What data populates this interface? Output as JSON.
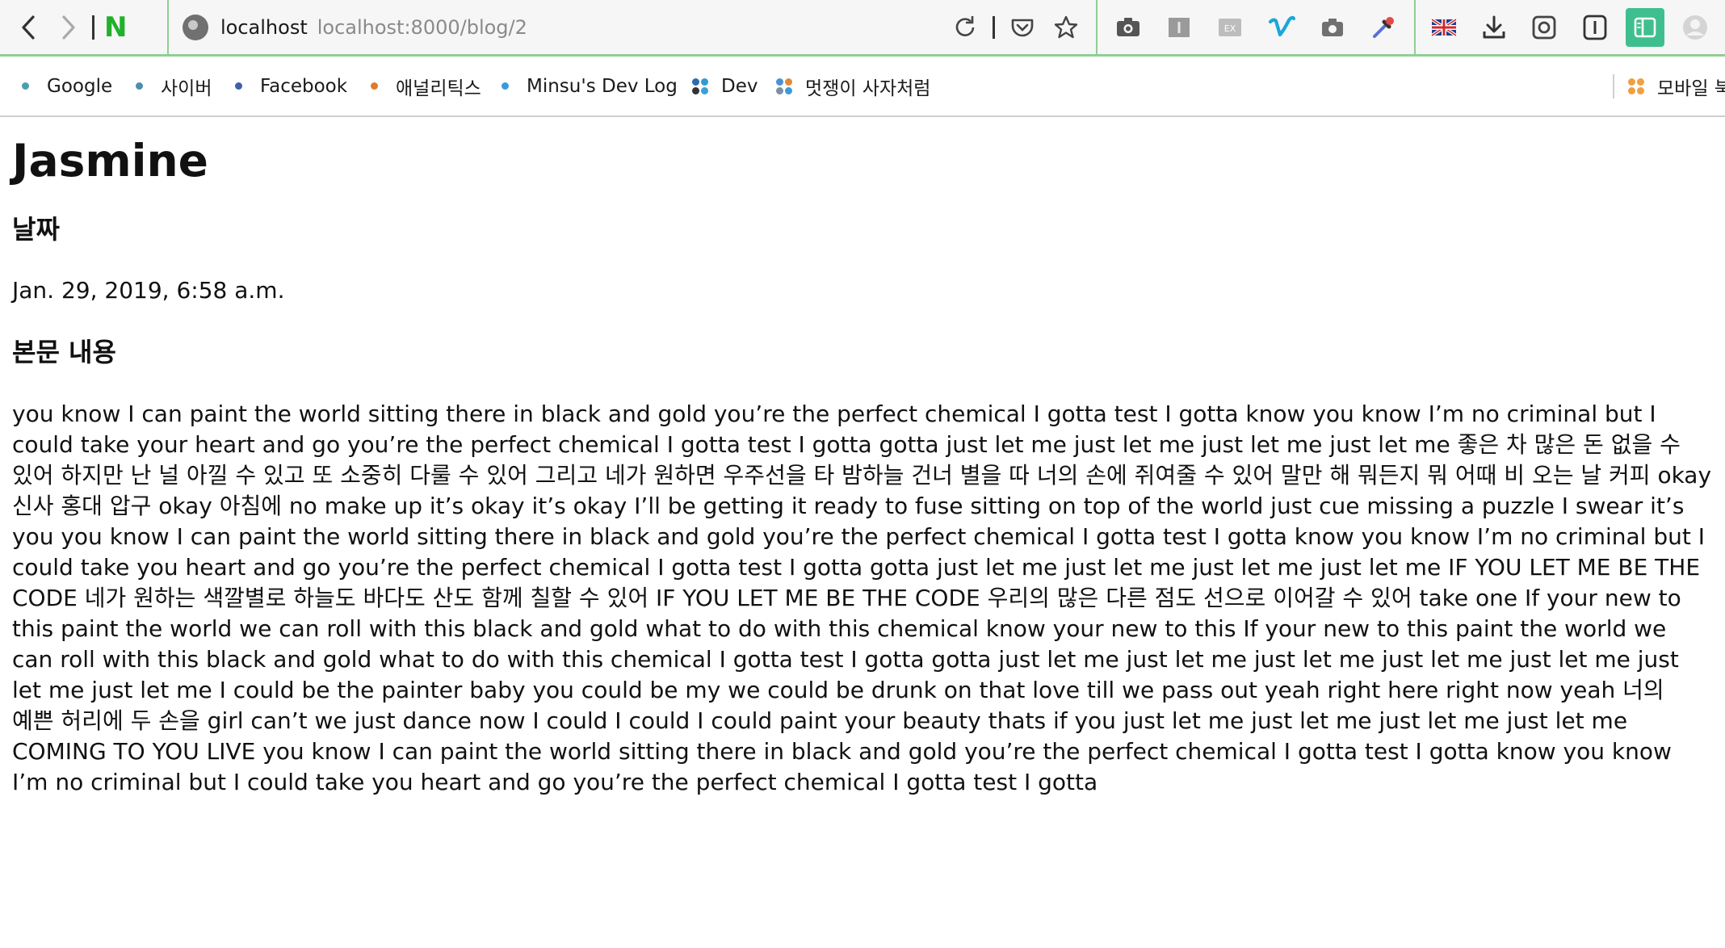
{
  "browser": {
    "host": "localhost",
    "url": "localhost:8000/blog/2",
    "nav_logo": "N"
  },
  "bookmarks": [
    {
      "label": "Google",
      "color": "#4aa0a8"
    },
    {
      "label": "사이버",
      "color": "#4a8fb0"
    },
    {
      "label": "Facebook",
      "color": "#3f5fa8"
    },
    {
      "label": "애널리틱스",
      "color": "#e07a2c"
    },
    {
      "label": "Minsu's Dev Log",
      "color": "#3a9bd8"
    },
    {
      "label": "Dev"
    },
    {
      "label": "멋쟁이 사자처럼"
    },
    {
      "label": "모바일 북"
    }
  ],
  "post": {
    "title": "Jasmine",
    "date_heading": "날짜",
    "date": "Jan. 29, 2019, 6:58 a.m.",
    "body_heading": "본문 내용",
    "body": "you know I can paint the world sitting there in black and gold you’re the perfect chemical I gotta test I gotta know you know I’m no criminal but I could take your heart and go you’re the perfect chemical I gotta test I gotta gotta just let me just let me just let me just let me 좋은 차 많은 돈 없을 수 있어 하지만 난 널 아낄 수 있고 또 소중히 다룰 수 있어 그리고 네가 원하면 우주선을 타 밤하늘 건너 별을 따 너의 손에 쥐여줄 수 있어 말만 해 뭐든지 뭐 어때 비 오는 날 커피 okay 신사 홍대 압구 okay 아침에 no make up it’s okay it’s okay I’ll be getting it ready to fuse sitting on top of the world just cue missing a puzzle I swear it’s you you know I can paint the world sitting there in black and gold you’re the perfect chemical I gotta test I gotta know you know I’m no criminal but I could take you heart and go you’re the perfect chemical I gotta test I gotta gotta just let me just let me just let me just let me IF YOU LET ME BE THE CODE 네가 원하는 색깔별로 하늘도 바다도 산도 함께 칠할 수 있어 IF YOU LET ME BE THE CODE 우리의 많은 다른 점도 선으로 이어갈 수 있어 take one If your new to this paint the world we can roll with this black and gold what to do with this chemical know your new to this If your new to this paint the world we can roll with this black and gold what to do with this chemical I gotta test I gotta gotta just let me just let me just let me just let me just let me just let me just let me I could be the painter baby you could be my we could be drunk on that love till we pass out yeah right here right now yeah 너의 예쁜 허리에 두 손을 girl can’t we just dance now I could I could I could paint your beauty thats if you just let me just let me just let me just let me COMING TO YOU LIVE you know I can paint the world sitting there in black and gold you’re the perfect chemical I gotta test I gotta know you know I’m no criminal but I could take you heart and go you’re the perfect chemical I gotta test I gotta"
  }
}
